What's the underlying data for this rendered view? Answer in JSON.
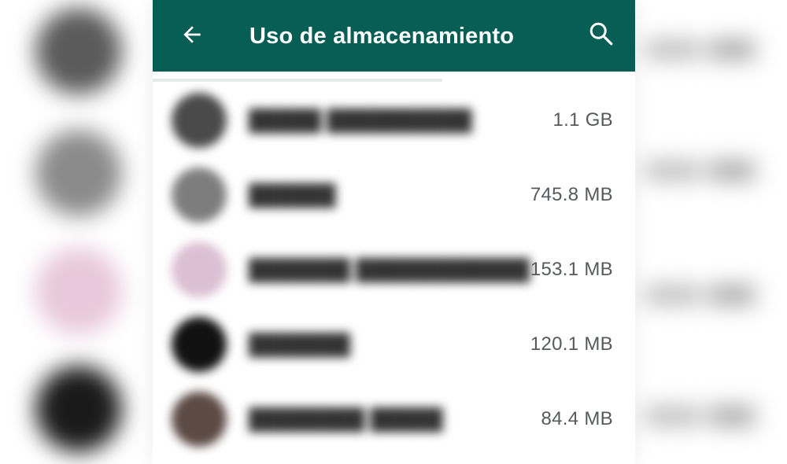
{
  "appbar": {
    "title": "Uso de almacenamiento",
    "background": "#075e54",
    "back_icon": "arrow-left-icon",
    "search_icon": "search-icon"
  },
  "chats": [
    {
      "avatar_color": "#4a4a4a",
      "size": "1.1 GB"
    },
    {
      "avatar_color": "#7d7d7d",
      "size": "745.8 MB"
    },
    {
      "avatar_color": "#dcbfd3",
      "size": "153.1 MB"
    },
    {
      "avatar_color": "#111111",
      "size": "120.1 MB"
    },
    {
      "avatar_color": "#5c4a44",
      "size": "84.4 MB"
    }
  ]
}
